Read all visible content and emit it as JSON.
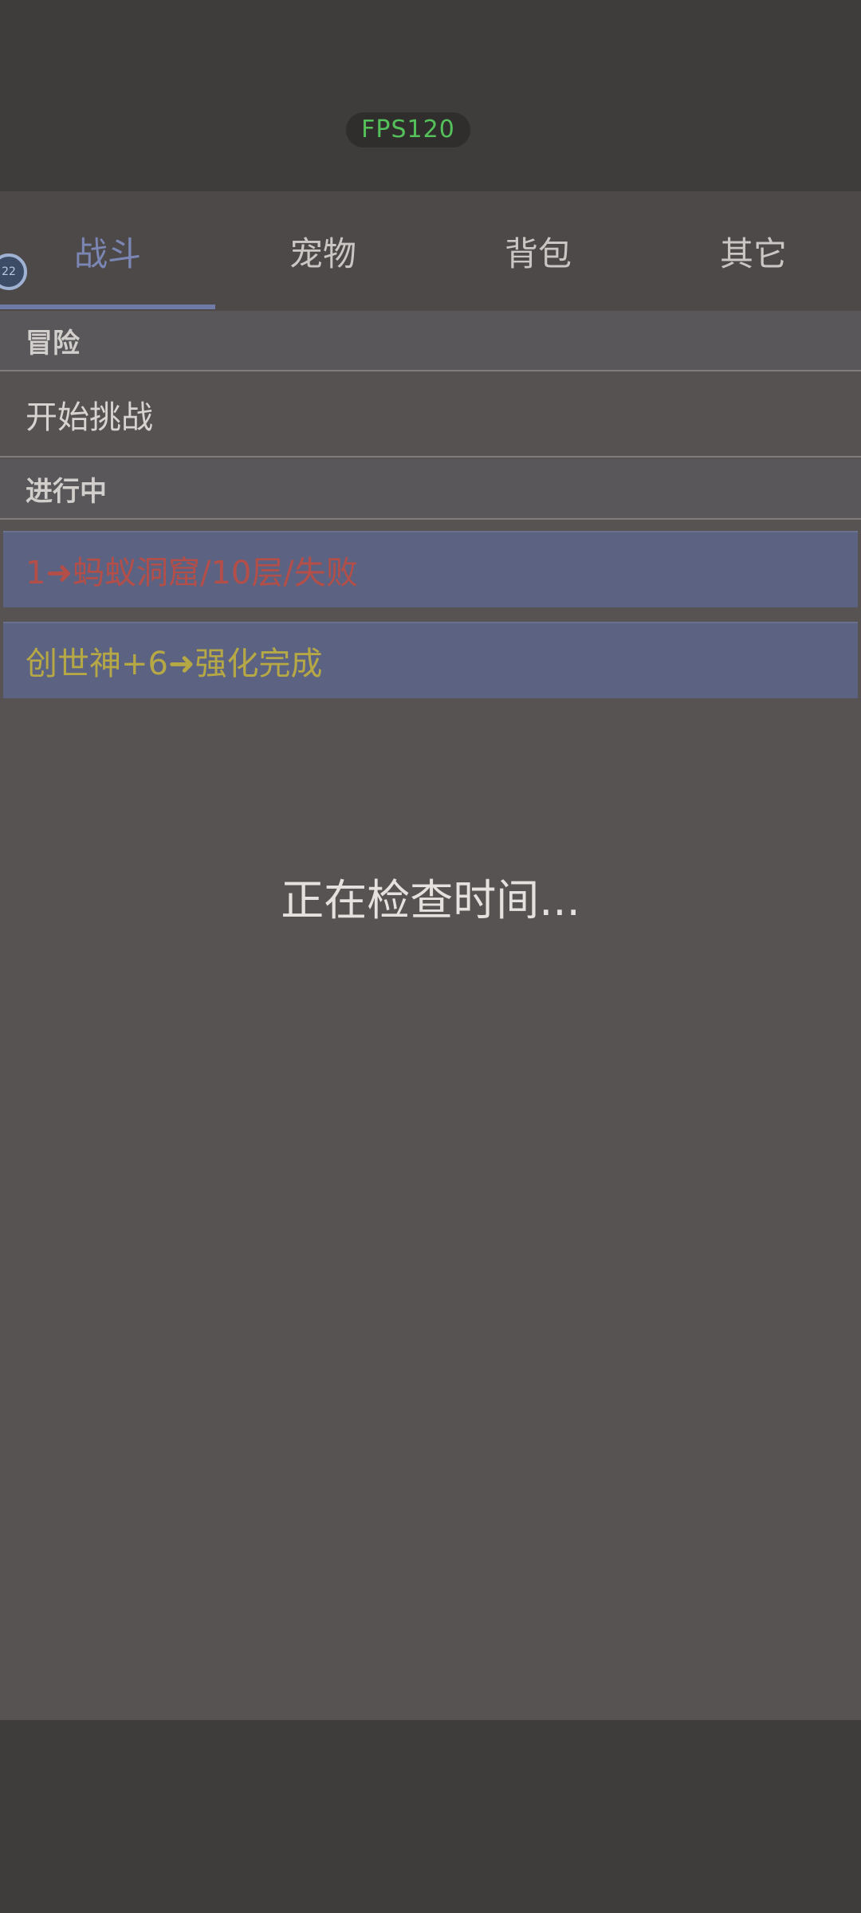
{
  "status_bar": {
    "fps_label": "FPS120"
  },
  "tabs": [
    {
      "label": "战斗"
    },
    {
      "label": "宠物"
    },
    {
      "label": "背包"
    },
    {
      "label": "其它"
    }
  ],
  "tab_marker": {
    "text": "22"
  },
  "sections": {
    "adventure_header": "冒险",
    "start_challenge": "开始挑战",
    "in_progress_header": "进行中"
  },
  "tasks": [
    {
      "text": "1➜蚂蚁洞窟/10层/失败"
    },
    {
      "text": "创世神+6➜强化完成"
    }
  ],
  "status": {
    "message": "正在检查时间..."
  },
  "colors": {
    "active_tab": "#7b86b5",
    "fps_green": "#55c15a",
    "task_fail": "#b34e48",
    "task_success": "#b7a846",
    "task_bg": "#5c6382"
  }
}
